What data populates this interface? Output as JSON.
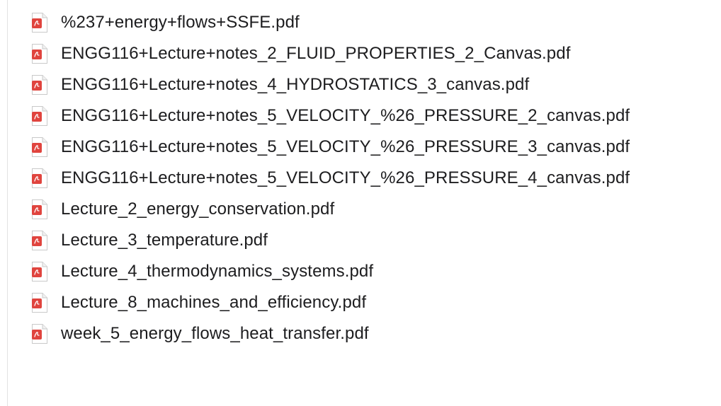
{
  "icon": "pdf-file-icon",
  "colors": {
    "pdf_red": "#e0443e",
    "text": "#1d1d1f"
  },
  "files": [
    {
      "name": "%237+energy+flows+SSFE.pdf"
    },
    {
      "name": "ENGG116+Lecture+notes_2_FLUID_PROPERTIES_2_Canvas.pdf"
    },
    {
      "name": "ENGG116+Lecture+notes_4_HYDROSTATICS_3_canvas.pdf"
    },
    {
      "name": "ENGG116+Lecture+notes_5_VELOCITY_%26_PRESSURE_2_canvas.pdf"
    },
    {
      "name": "ENGG116+Lecture+notes_5_VELOCITY_%26_PRESSURE_3_canvas.pdf"
    },
    {
      "name": "ENGG116+Lecture+notes_5_VELOCITY_%26_PRESSURE_4_canvas.pdf"
    },
    {
      "name": "Lecture_2_energy_conservation.pdf"
    },
    {
      "name": "Lecture_3_temperature.pdf"
    },
    {
      "name": "Lecture_4_thermodynamics_systems.pdf"
    },
    {
      "name": "Lecture_8_machines_and_efficiency.pdf"
    },
    {
      "name": "week_5_energy_flows_heat_transfer.pdf"
    }
  ]
}
